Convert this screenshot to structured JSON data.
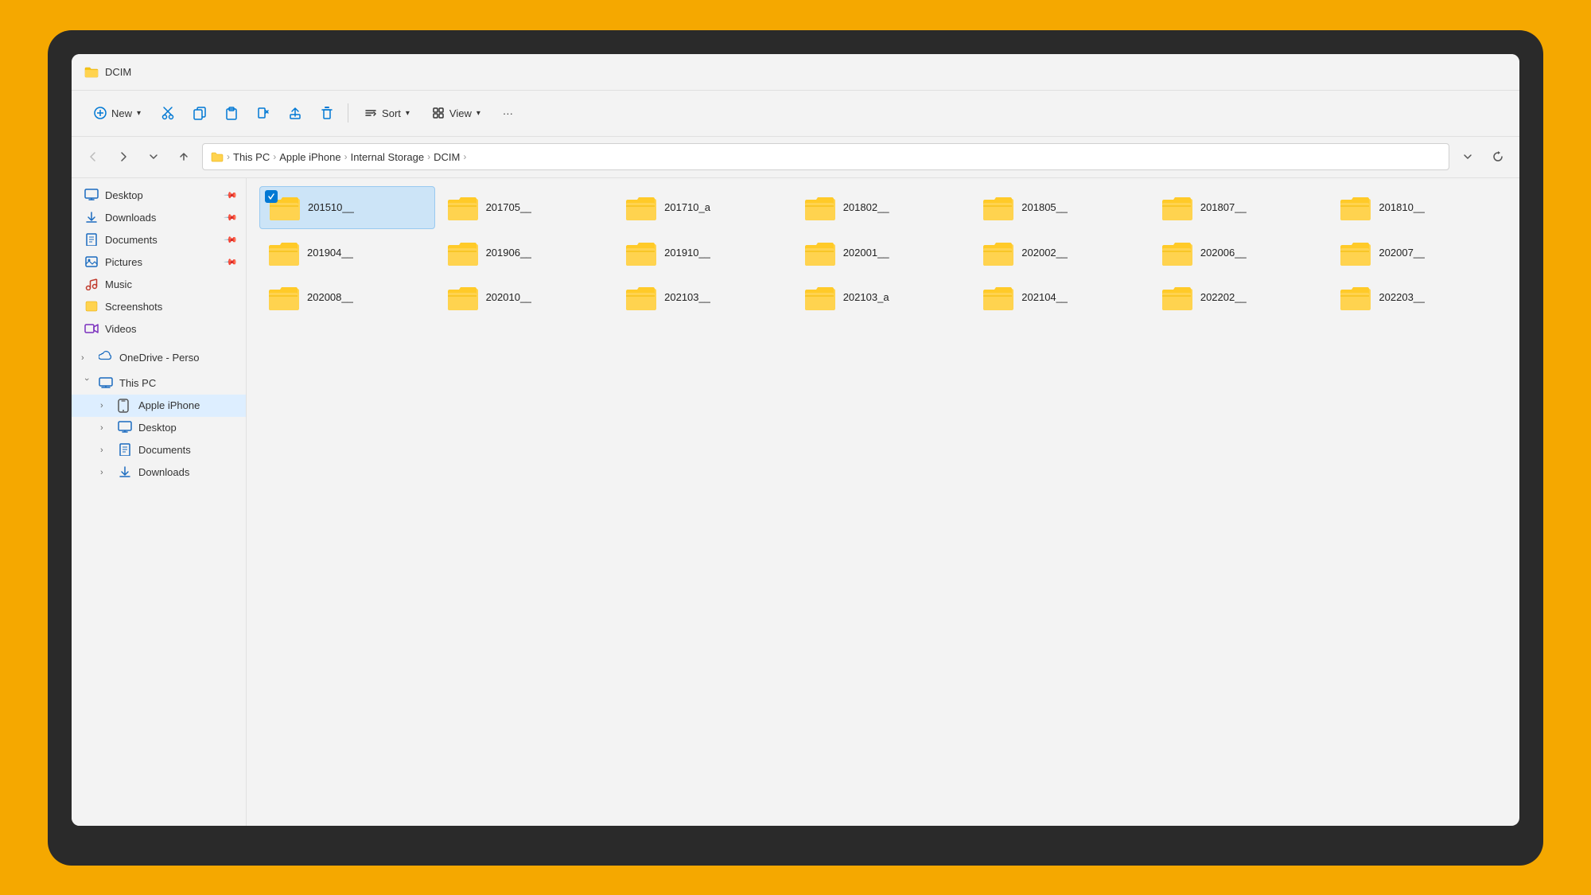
{
  "window": {
    "title": "DCIM",
    "title_icon": "folder"
  },
  "toolbar": {
    "new_label": "New",
    "sort_label": "Sort",
    "view_label": "View",
    "more_label": "···"
  },
  "breadcrumb": {
    "items": [
      "This PC",
      "Apple iPhone",
      "Internal Storage",
      "DCIM"
    ]
  },
  "sidebar": {
    "pinned": [
      {
        "label": "Desktop",
        "icon": "desktop",
        "pinned": true
      },
      {
        "label": "Downloads",
        "icon": "downloads",
        "pinned": true
      },
      {
        "label": "Documents",
        "icon": "documents",
        "pinned": true
      },
      {
        "label": "Pictures",
        "icon": "pictures",
        "pinned": true
      },
      {
        "label": "Music",
        "icon": "music",
        "pinned": false
      },
      {
        "label": "Screenshots",
        "icon": "screenshots",
        "pinned": false
      },
      {
        "label": "Videos",
        "icon": "videos",
        "pinned": false
      }
    ],
    "onedrive": {
      "label": "OneDrive - Perso",
      "expanded": false
    },
    "thispc": {
      "label": "This PC",
      "expanded": true,
      "children": [
        {
          "label": "Apple iPhone",
          "expanded": false
        },
        {
          "label": "Desktop",
          "expanded": false
        },
        {
          "label": "Documents",
          "expanded": false
        },
        {
          "label": "Downloads",
          "expanded": false
        }
      ]
    }
  },
  "folders": [
    {
      "name": "201510__",
      "selected": true
    },
    {
      "name": "201705__",
      "selected": false
    },
    {
      "name": "201710_a",
      "selected": false
    },
    {
      "name": "201802__",
      "selected": false
    },
    {
      "name": "201805__",
      "selected": false
    },
    {
      "name": "201807__",
      "selected": false
    },
    {
      "name": "201810__",
      "selected": false
    },
    {
      "name": "201904__",
      "selected": false
    },
    {
      "name": "201906__",
      "selected": false
    },
    {
      "name": "201910__",
      "selected": false
    },
    {
      "name": "202001__",
      "selected": false
    },
    {
      "name": "202002__",
      "selected": false
    },
    {
      "name": "202006__",
      "selected": false
    },
    {
      "name": "202007__",
      "selected": false
    },
    {
      "name": "202008__",
      "selected": false
    },
    {
      "name": "202010__",
      "selected": false
    },
    {
      "name": "202103__",
      "selected": false
    },
    {
      "name": "202103_a",
      "selected": false
    },
    {
      "name": "202104__",
      "selected": false
    },
    {
      "name": "202202__",
      "selected": false
    },
    {
      "name": "202203__",
      "selected": false
    }
  ]
}
